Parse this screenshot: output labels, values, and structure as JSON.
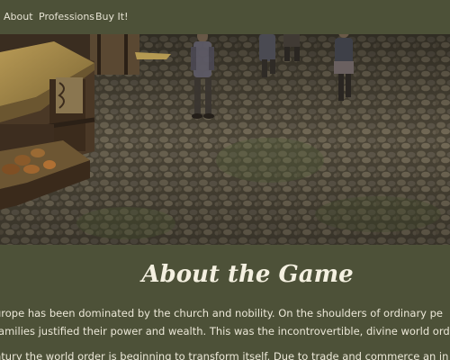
{
  "nav": {
    "items": [
      {
        "label": "About"
      },
      {
        "label": "Professions"
      },
      {
        "label": "Buy It!"
      }
    ]
  },
  "hero": {
    "scene": "medieval-village-street"
  },
  "about": {
    "title": "About the Game",
    "paragraph1_line1": "urope has been dominated by the church and nobility. On the shoulders of ordinary pe",
    "paragraph1_line2": "families justified their power and wealth. This was the incontrovertible, divine world ord",
    "paragraph2_line1": "ntury the world order is beginning to transform itself. Due to trade and commerce an in"
  },
  "colors": {
    "background": "#4d5138",
    "text": "#ece8d8"
  }
}
